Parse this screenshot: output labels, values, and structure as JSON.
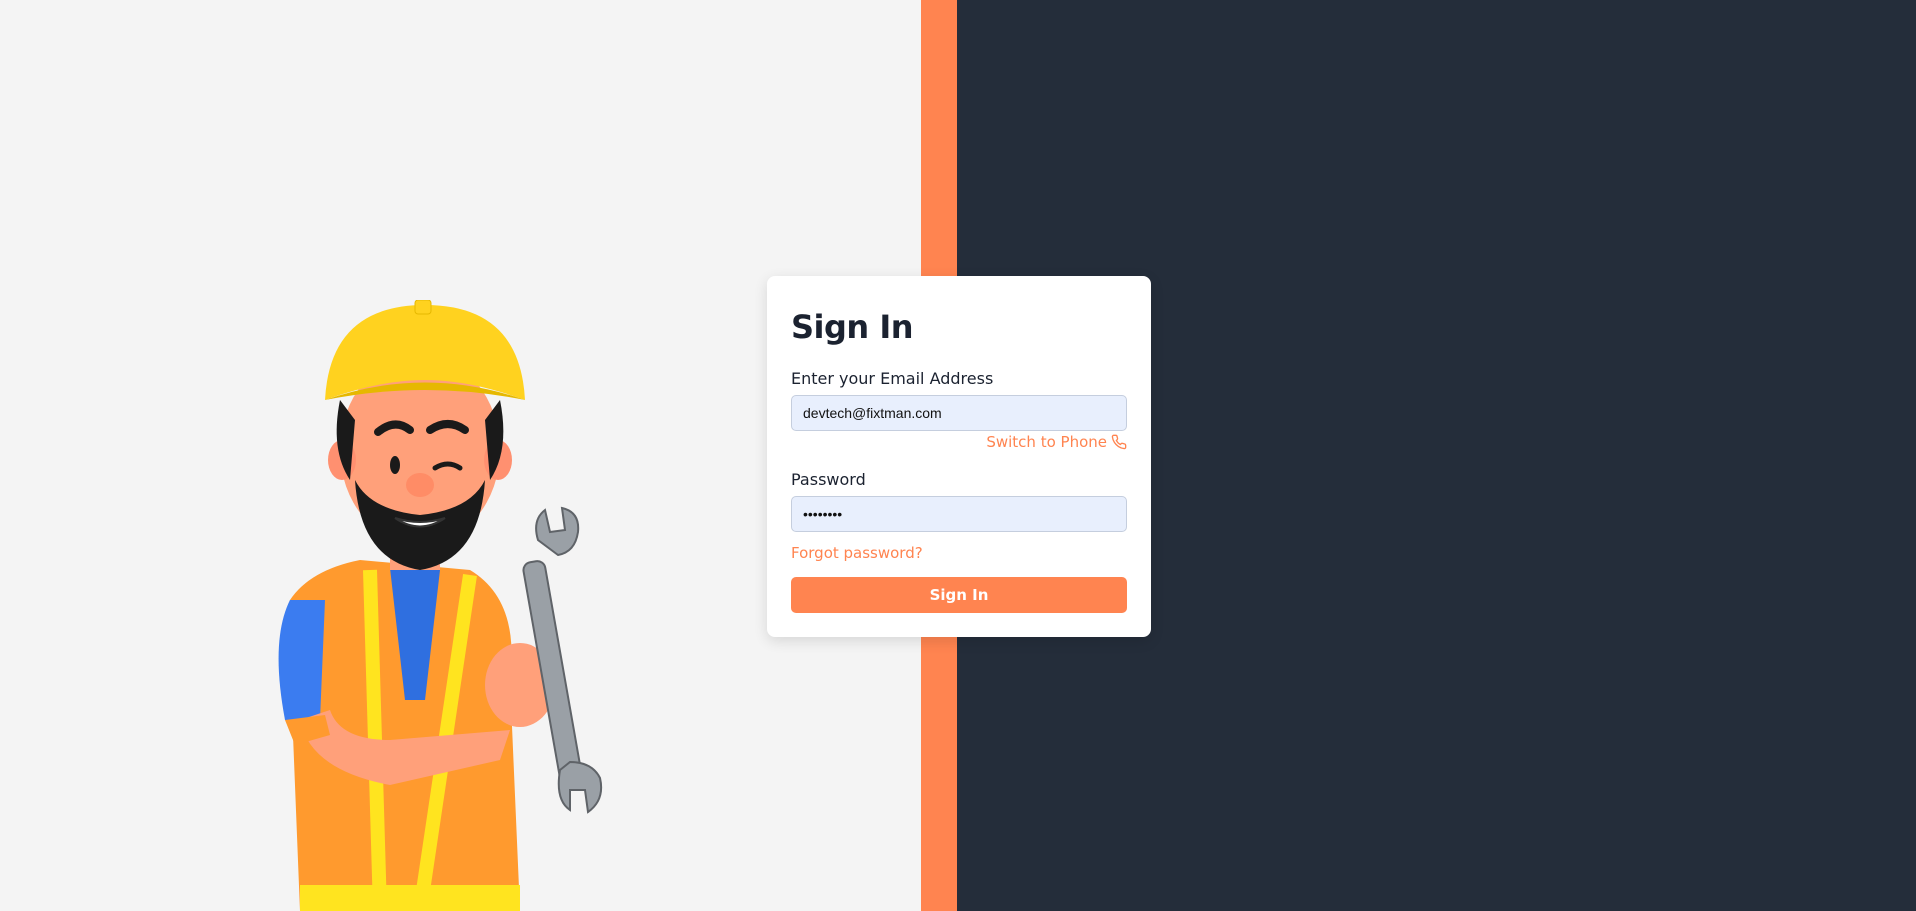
{
  "signin": {
    "title": "Sign In",
    "email_label": "Enter your Email Address",
    "email_value": "devtech@fixtman.com",
    "switch_label": "Switch to Phone",
    "password_label": "Password",
    "password_value": "••••••••",
    "forgot_label": "Forgot password?",
    "button_label": "Sign In"
  },
  "colors": {
    "accent": "#ff8450",
    "dark_panel": "#242d3a",
    "light_panel": "#f4f4f4",
    "input_bg": "#e8effd"
  },
  "icons": {
    "switch": "phone-icon",
    "illustration": "construction-worker-illustration"
  }
}
